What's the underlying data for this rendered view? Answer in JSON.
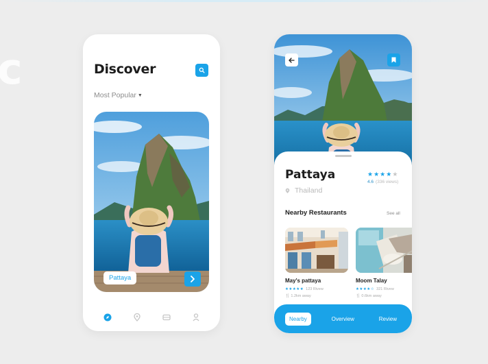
{
  "discover_screen": {
    "title": "Discover",
    "filter_label": "Most Popular",
    "hero_card": {
      "place_name": "Pattaya"
    },
    "bottom_nav": [
      "compass-icon",
      "location-pin-icon",
      "ticket-icon",
      "profile-icon"
    ]
  },
  "detail_screen": {
    "place_name": "Pattaya",
    "country": "Thailand",
    "rating": {
      "stars_filled": 4,
      "stars_total": 5,
      "score": "4.6",
      "views": "(336 views)"
    },
    "section_title": "Nearby Restaurants",
    "see_all_label": "See all",
    "restaurants": [
      {
        "name": "May's pattaya",
        "reviews": "123 Rivew",
        "distance": "1.2km away"
      },
      {
        "name": "Moom Talay",
        "reviews": "321 Rivew",
        "distance": "0.6km away"
      }
    ],
    "tabs": [
      {
        "label": "Nearby",
        "active": true
      },
      {
        "label": "Overview",
        "active": false
      },
      {
        "label": "Review",
        "active": false
      }
    ]
  },
  "colors": {
    "accent": "#1aa3e8",
    "background": "#ededed",
    "card": "#ffffff"
  }
}
